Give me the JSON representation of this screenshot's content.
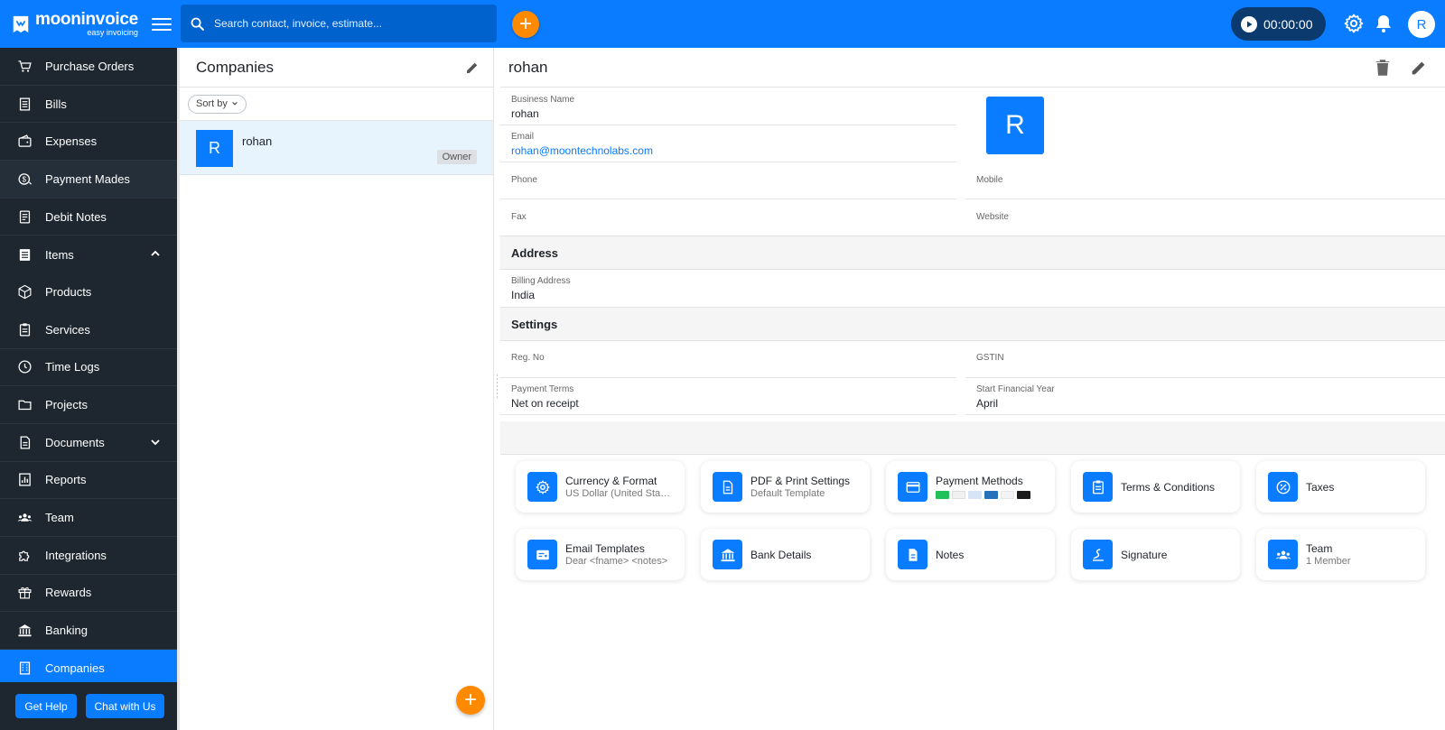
{
  "app": {
    "brand_name": "mooninvoice",
    "brand_tagline": "easy invoicing",
    "search_placeholder": "Search contact, invoice, estimate...",
    "timer": "00:00:00",
    "user_initial": "R",
    "accent_color": "#0a7cff",
    "fab_color": "#ff8a00"
  },
  "sidebar": {
    "items": [
      {
        "label": "Purchase Orders",
        "icon": "cart-icon"
      },
      {
        "label": "Bills",
        "icon": "bill-icon"
      },
      {
        "label": "Expenses",
        "icon": "wallet-icon"
      },
      {
        "label": "Payment Mades",
        "icon": "payment-icon"
      },
      {
        "label": "Debit Notes",
        "icon": "note-icon"
      },
      {
        "label": "Items",
        "icon": "items-icon"
      },
      {
        "label": "Products",
        "icon": "box-icon"
      },
      {
        "label": "Services",
        "icon": "clipboard-icon"
      },
      {
        "label": "Time Logs",
        "icon": "clock-icon"
      },
      {
        "label": "Projects",
        "icon": "folder-icon"
      },
      {
        "label": "Documents",
        "icon": "document-icon"
      },
      {
        "label": "Reports",
        "icon": "reports-icon"
      },
      {
        "label": "Team",
        "icon": "team-icon"
      },
      {
        "label": "Integrations",
        "icon": "puzzle-icon"
      },
      {
        "label": "Rewards",
        "icon": "gift-icon"
      },
      {
        "label": "Banking",
        "icon": "bank-icon"
      },
      {
        "label": "Companies",
        "icon": "building-icon"
      }
    ],
    "get_help": "Get Help",
    "chat": "Chat with Us"
  },
  "companies": {
    "title": "Companies",
    "sort_label": "Sort by",
    "list": [
      {
        "initial": "R",
        "name": "rohan",
        "badge": "Owner"
      }
    ]
  },
  "detail": {
    "title": "rohan",
    "avatar_initial": "R",
    "fields": {
      "business_name_label": "Business Name",
      "business_name": "rohan",
      "email_label": "Email",
      "email": "rohan@moontechnolabs.com",
      "phone_label": "Phone",
      "mobile_label": "Mobile",
      "fax_label": "Fax",
      "website_label": "Website"
    },
    "address_section": "Address",
    "billing_address_label": "Billing Address",
    "billing_address": "India",
    "settings_section": "Settings",
    "reg_no_label": "Reg. No",
    "gstin_label": "GSTIN",
    "payment_terms_label": "Payment Terms",
    "payment_terms": "Net on receipt",
    "start_fy_label": "Start Financial Year",
    "start_fy": "April"
  },
  "cards": [
    {
      "title": "Currency & Format",
      "subtitle": "US Dollar (United States)",
      "icon": "gear-icon"
    },
    {
      "title": "PDF & Print Settings",
      "subtitle": "Default Template",
      "icon": "pdf-icon"
    },
    {
      "title": "Payment Methods",
      "subtitle": "",
      "icon": "card-icon"
    },
    {
      "title": "Terms & Conditions",
      "subtitle": "",
      "icon": "terms-icon"
    },
    {
      "title": "Taxes",
      "subtitle": "",
      "icon": "percent-icon"
    },
    {
      "title": "Email Templates",
      "subtitle": "Dear <fname> <notes>",
      "icon": "email-template-icon"
    },
    {
      "title": "Bank Details",
      "subtitle": "",
      "icon": "bank-icon"
    },
    {
      "title": "Notes",
      "subtitle": "",
      "icon": "notes-icon"
    },
    {
      "title": "Signature",
      "subtitle": "",
      "icon": "signature-icon"
    },
    {
      "title": "Team",
      "subtitle": "1 Member",
      "icon": "team-icon"
    }
  ]
}
